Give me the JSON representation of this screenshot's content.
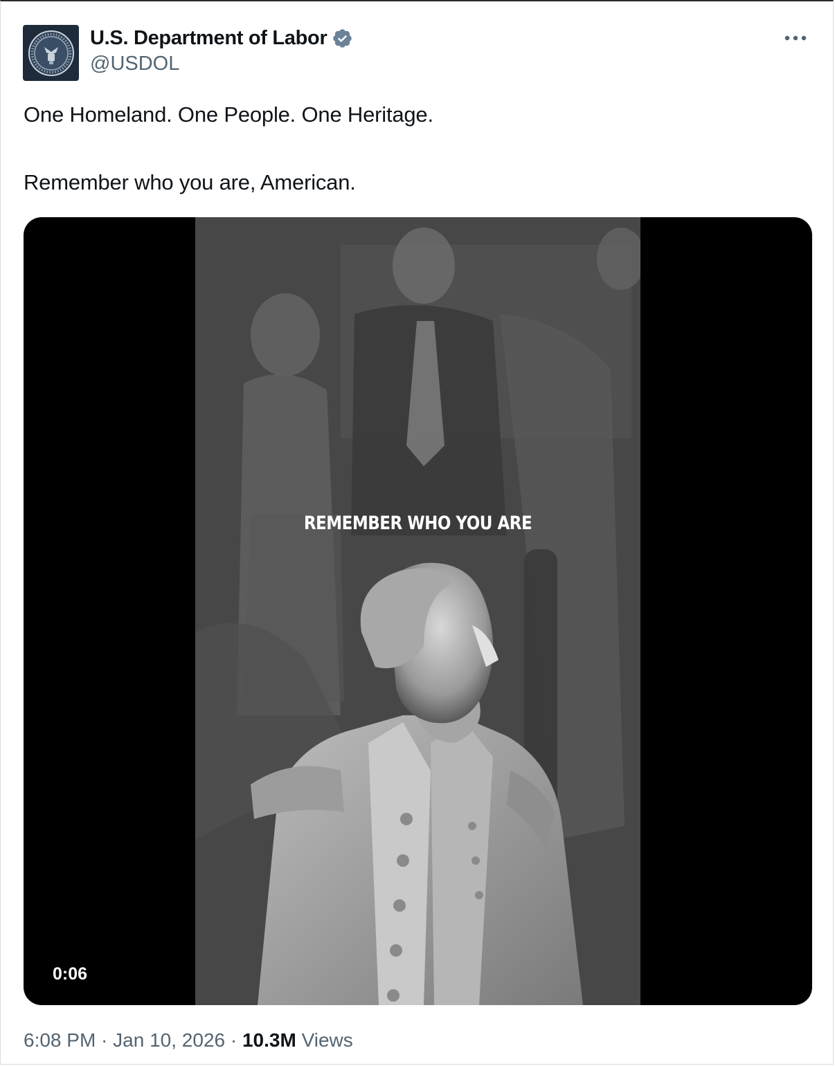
{
  "author": {
    "display_name": "U.S. Department of Labor",
    "handle": "@USDOL",
    "verified": true,
    "avatar_icon": "department-of-labor-seal-icon"
  },
  "tweet": {
    "line1": "One Homeland. One People. One Heritage.",
    "line2": "Remember who you are, American."
  },
  "media": {
    "overlay_text": "REMEMBER WHO YOU ARE",
    "duration": "0:06"
  },
  "meta": {
    "time": "6:08 PM",
    "separator": " · ",
    "date": "Jan 10, 2026",
    "views_count": "10.3M",
    "views_label": " Views"
  },
  "colors": {
    "text_primary": "#0f1419",
    "text_secondary": "#536471",
    "verified_blue": "#6b8299",
    "media_background": "#000000"
  }
}
